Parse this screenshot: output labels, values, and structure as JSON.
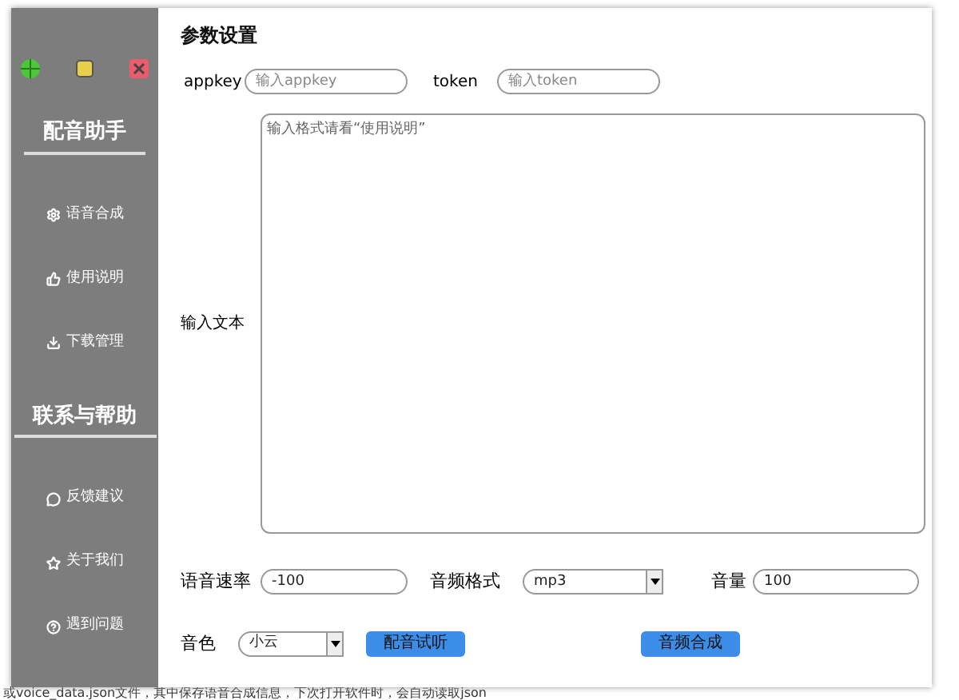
{
  "background": {
    "bottom_line": "或voice_data.json文件，其中保存语音合成信息，下次打开软件时，会自动读取json"
  },
  "sidebar": {
    "sections": [
      {
        "title": "配音助手",
        "items": [
          "语音合成",
          "使用说明",
          "下载管理"
        ]
      },
      {
        "title": "联系与帮助",
        "items": [
          "反馈建议",
          "关于我们",
          "遇到问题"
        ]
      }
    ]
  },
  "panel": {
    "title": "参数设置",
    "appkey": {
      "label": "appkey",
      "placeholder": "输入appkey"
    },
    "token": {
      "label": "token",
      "placeholder": "输入token"
    },
    "text": {
      "label": "输入文本",
      "placeholder": "输入格式请看“使用说明”"
    },
    "speed": {
      "label": "语音速率",
      "value": "-100"
    },
    "format": {
      "label": "音频格式",
      "value": "mp3"
    },
    "volume": {
      "label": "音量",
      "value": "100"
    },
    "voice": {
      "label": "音色",
      "value": "小云"
    },
    "buttons": [
      "配音试听",
      "音频合成"
    ]
  }
}
